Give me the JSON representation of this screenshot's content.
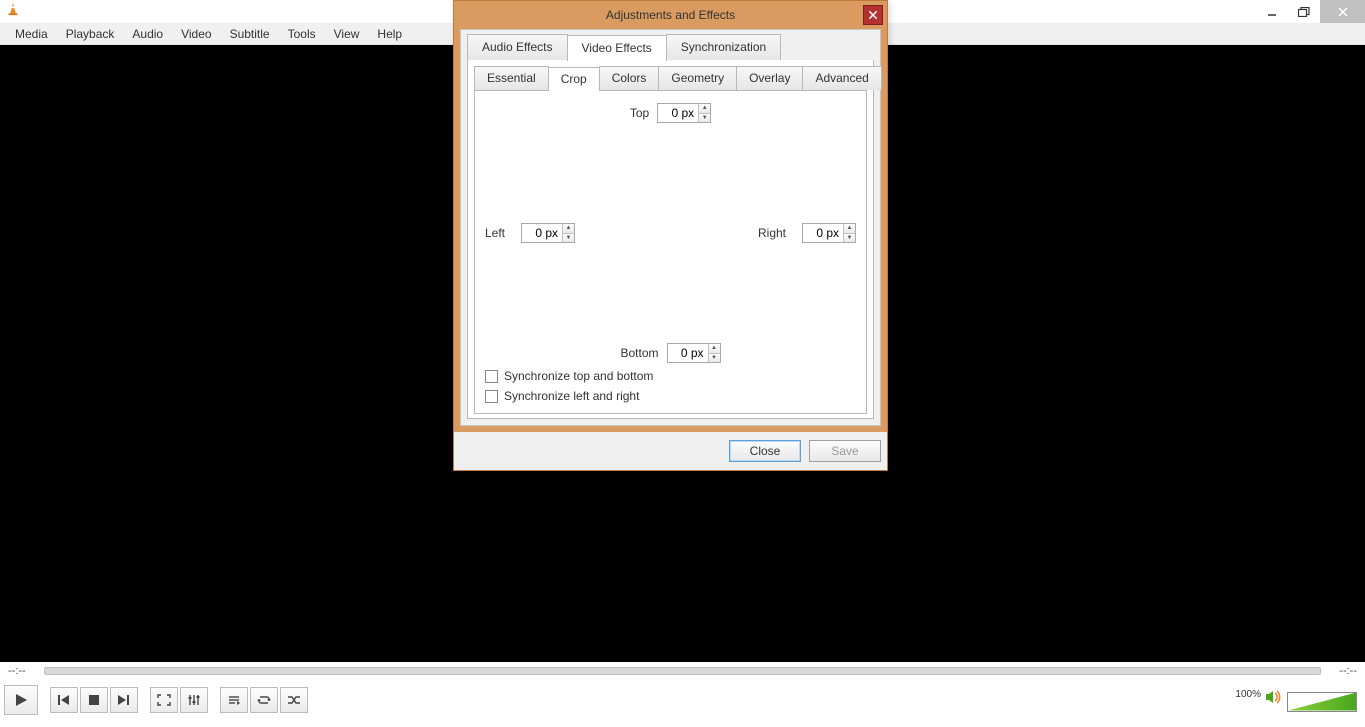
{
  "menubar": [
    "Media",
    "Playback",
    "Audio",
    "Video",
    "Subtitle",
    "Tools",
    "View",
    "Help"
  ],
  "time": {
    "left": "--:--",
    "right": "--:--"
  },
  "volume": {
    "label": "100%"
  },
  "dialog": {
    "title": "Adjustments and Effects",
    "tabs": {
      "audio": "Audio Effects",
      "video": "Video Effects",
      "sync": "Synchronization"
    },
    "subtabs": {
      "essential": "Essential",
      "crop": "Crop",
      "colors": "Colors",
      "geometry": "Geometry",
      "overlay": "Overlay",
      "advanced": "Advanced"
    },
    "crop": {
      "top_label": "Top",
      "top_value": "0 px",
      "left_label": "Left",
      "left_value": "0 px",
      "right_label": "Right",
      "right_value": "0 px",
      "bottom_label": "Bottom",
      "bottom_value": "0 px",
      "sync_tb": "Synchronize top and bottom",
      "sync_lr": "Synchronize left and right"
    },
    "buttons": {
      "close": "Close",
      "save": "Save"
    }
  }
}
